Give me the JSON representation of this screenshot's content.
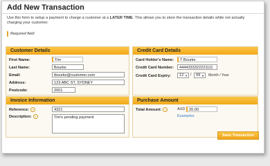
{
  "page": {
    "title": "Add New Transaction",
    "intro_before": "Use this form to setup a payment to charge a customer at a ",
    "intro_bold": "LATER TIME",
    "intro_after": ". This allows you to store the transaction details while not actually charging your customer.",
    "required_note": "Required field"
  },
  "customer": {
    "heading": "Customer Details",
    "first_name_label": "First Name:",
    "first_name": "Tim",
    "last_name_label": "Last Name:",
    "last_name": "Bourke",
    "email_label": "Email:",
    "email": "tbourke@customer.com",
    "address_label": "Address:",
    "address": "123 ABC ST, SYDNEY",
    "postcode_label": "Postcode:",
    "postcode": "2001"
  },
  "card": {
    "heading": "Credit Card Details",
    "holder_label": "Card Holder's Name:",
    "holder": "T Bourke",
    "number_label": "Credit Card Number:",
    "number": "4444333322221111",
    "expiry_label": "Credit Card Expiry:",
    "expiry_month": "12",
    "expiry_year": "09",
    "expiry_hint": "Month / Year"
  },
  "invoice": {
    "heading": "Invoice Information",
    "reference_label": "Reference:",
    "reference": "4321",
    "description_label": "Description:",
    "description": "Tim's pending payment"
  },
  "amount": {
    "heading": "Purchase Amount",
    "total_label": "Total Amount:",
    "currency": "AUD",
    "total": "20.00",
    "examples_link": "Examples"
  },
  "actions": {
    "save_label": "Save Transaction"
  },
  "colors": {
    "accent": "#f2a81a",
    "link": "#3a76c4"
  },
  "icons": {
    "help": "help-icon"
  }
}
